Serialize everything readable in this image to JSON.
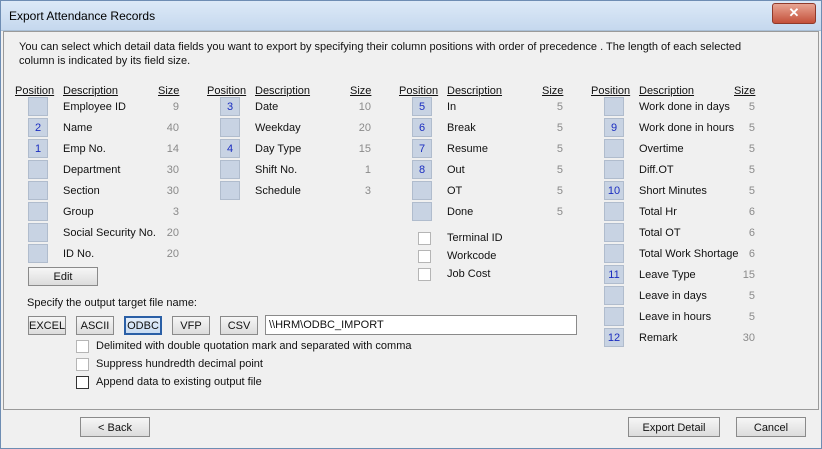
{
  "window": {
    "title": "Export Attendance Records",
    "close_label": "✕"
  },
  "intro": "You can select which detail data fields you want to export by specifying their column positions with order of  precedence . The length of each selected column is indicated by its field size.",
  "headers": {
    "position": "Position",
    "description": "Description",
    "size": "Size"
  },
  "columns": [
    {
      "rows": [
        {
          "pos": "",
          "desc": "Employee ID",
          "size": "9"
        },
        {
          "pos": "2",
          "desc": "Name",
          "size": "40"
        },
        {
          "pos": "1",
          "desc": "Emp No.",
          "size": "14"
        },
        {
          "pos": "",
          "desc": "Department",
          "size": "30"
        },
        {
          "pos": "",
          "desc": "Section",
          "size": "30"
        },
        {
          "pos": "",
          "desc": "Group",
          "size": "3"
        },
        {
          "pos": "",
          "desc": "Social Security No.",
          "size": "20"
        },
        {
          "pos": "",
          "desc": "ID No.",
          "size": "20"
        }
      ]
    },
    {
      "rows": [
        {
          "pos": "3",
          "desc": "Date",
          "size": "10"
        },
        {
          "pos": "",
          "desc": "Weekday",
          "size": "20"
        },
        {
          "pos": "4",
          "desc": "Day Type",
          "size": "15"
        },
        {
          "pos": "",
          "desc": "Shift No.",
          "size": "1"
        },
        {
          "pos": "",
          "desc": "Schedule",
          "size": "3"
        }
      ]
    },
    {
      "rows": [
        {
          "pos": "5",
          "desc": "In",
          "size": "5"
        },
        {
          "pos": "6",
          "desc": "Break",
          "size": "5"
        },
        {
          "pos": "7",
          "desc": "Resume",
          "size": "5"
        },
        {
          "pos": "8",
          "desc": "Out",
          "size": "5"
        },
        {
          "pos": "",
          "desc": "OT",
          "size": "5"
        },
        {
          "pos": "",
          "desc": "Done",
          "size": "5"
        }
      ]
    },
    {
      "rows": [
        {
          "pos": "",
          "desc": "Work done in days",
          "size": "5"
        },
        {
          "pos": "9",
          "desc": "Work done in hours",
          "size": "5"
        },
        {
          "pos": "",
          "desc": "Overtime",
          "size": "5"
        },
        {
          "pos": "",
          "desc": "Diff.OT",
          "size": "5"
        },
        {
          "pos": "10",
          "desc": "Short Minutes",
          "size": "5"
        },
        {
          "pos": "",
          "desc": "Total Hr",
          "size": "6"
        },
        {
          "pos": "",
          "desc": "Total OT",
          "size": "6"
        },
        {
          "pos": "",
          "desc": "Total Work Shortage",
          "size": "6"
        },
        {
          "pos": "11",
          "desc": "Leave Type",
          "size": "15"
        },
        {
          "pos": "",
          "desc": "Leave in days",
          "size": "5"
        },
        {
          "pos": "",
          "desc": "Leave in hours",
          "size": "5"
        },
        {
          "pos": "12",
          "desc": "Remark",
          "size": "30"
        }
      ]
    }
  ],
  "extra_fields": [
    "Terminal ID",
    "Workcode",
    "Job Cost"
  ],
  "edit_label": "Edit",
  "output": {
    "prompt": "Specify the output target file name:",
    "formats": [
      "EXCEL",
      "ASCII",
      "ODBC",
      "VFP",
      "CSV"
    ],
    "selected_format": "ODBC",
    "path": "\\\\HRM\\ODBC_IMPORT"
  },
  "options": [
    "Delimited with double quotation mark and separated with comma",
    "Suppress hundredth decimal point",
    "Append data to existing output file"
  ],
  "footer": {
    "back_label": "< Back",
    "export_label": "Export Detail",
    "cancel_label": "Cancel"
  }
}
